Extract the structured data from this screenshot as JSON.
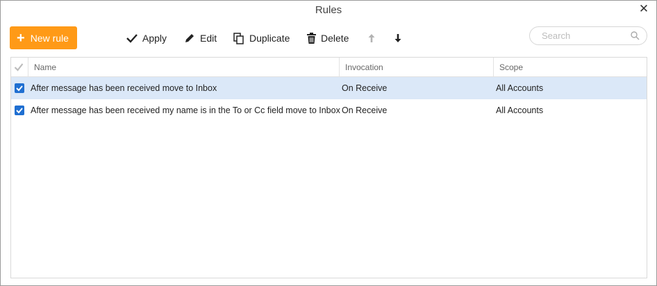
{
  "window": {
    "title": "Rules",
    "close_icon": "close-icon"
  },
  "toolbar": {
    "new_rule_label": "New rule",
    "apply_label": "Apply",
    "edit_label": "Edit",
    "duplicate_label": "Duplicate",
    "delete_label": "Delete",
    "move_up_icon": "arrow-up-icon",
    "move_down_icon": "arrow-down-icon"
  },
  "search": {
    "placeholder": "Search",
    "value": ""
  },
  "table": {
    "columns": [
      "Name",
      "Invocation",
      "Scope"
    ],
    "rows": [
      {
        "checked": true,
        "selected": true,
        "name": "After message has been received move to Inbox",
        "invocation": "On Receive",
        "scope": "All Accounts"
      },
      {
        "checked": true,
        "selected": false,
        "name": "After message has been received my name is in the To or Cc field move to Inbox",
        "invocation": "On Receive",
        "scope": "All Accounts"
      }
    ]
  },
  "colors": {
    "accent": "#ff9a17",
    "checkbox": "#1f6fd1",
    "selected_row": "#dbe8f8"
  }
}
